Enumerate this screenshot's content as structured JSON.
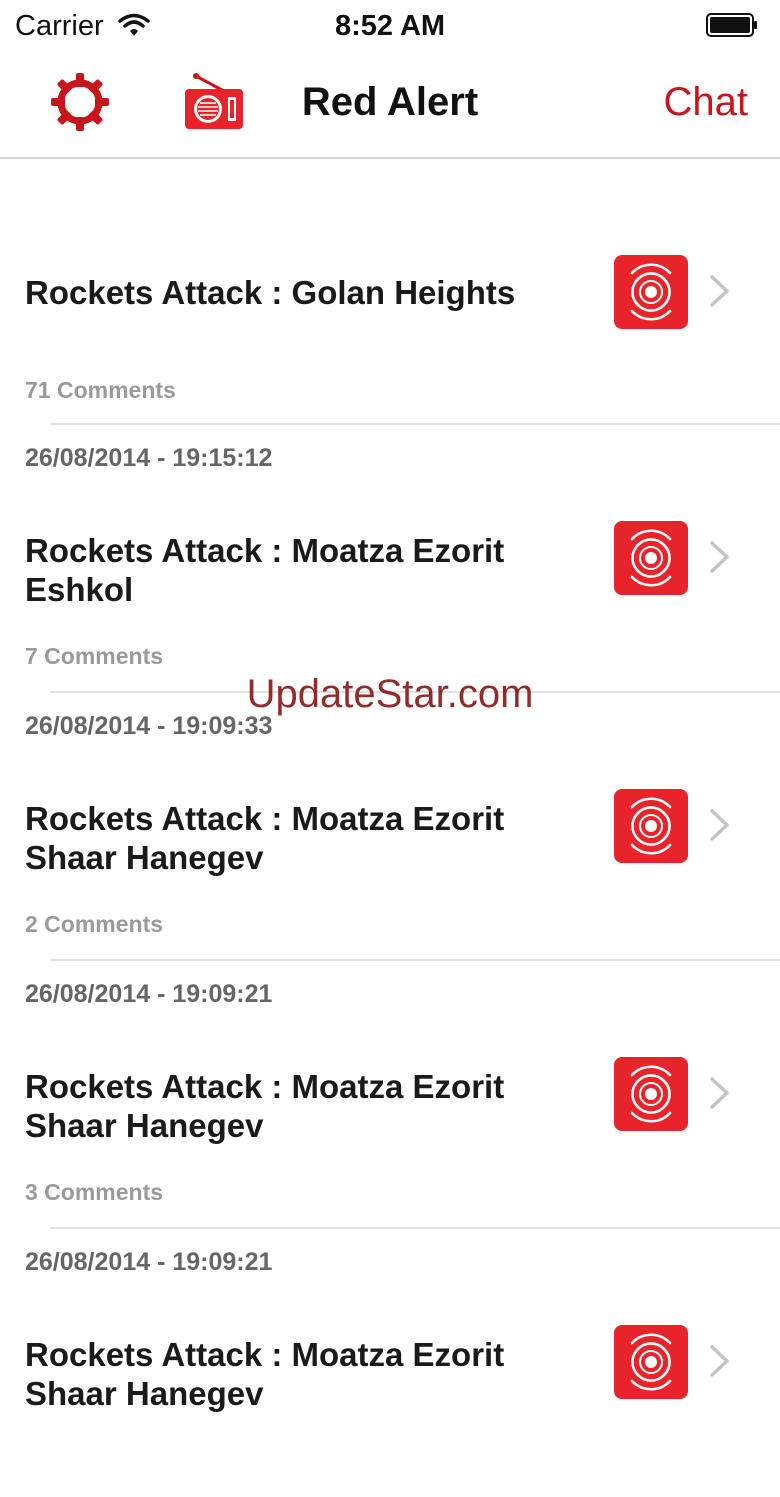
{
  "status_bar": {
    "carrier": "Carrier",
    "time": "8:52 AM"
  },
  "nav": {
    "title": "Red Alert",
    "chat_label": "Chat",
    "left_icons": [
      "gear-icon",
      "radio-icon"
    ]
  },
  "colors": {
    "accent": "#c8141b",
    "alert_icon_bg": "#e8232a",
    "date_text": "#666666",
    "comments_text": "#9a9a9a"
  },
  "alerts": [
    {
      "date": "",
      "title": "Rockets Attack : Golan Heights",
      "comments": "71 Comments",
      "icon": "siren-icon"
    },
    {
      "date": "26/08/2014 - 19:15:12",
      "title": "Rockets Attack : Moatza Ezorit Eshkol",
      "comments": "7 Comments",
      "icon": "siren-icon"
    },
    {
      "date": "26/08/2014 - 19:09:33",
      "title": "Rockets Attack : Moatza Ezorit Shaar Hanegev",
      "comments": "2 Comments",
      "icon": "siren-icon"
    },
    {
      "date": "26/08/2014 - 19:09:21",
      "title": "Rockets Attack : Moatza Ezorit Shaar Hanegev",
      "comments": "3 Comments",
      "icon": "siren-icon"
    },
    {
      "date": "26/08/2014 - 19:09:21",
      "title": "Rockets Attack : Moatza Ezorit Shaar Hanegev",
      "comments": "",
      "icon": "siren-icon"
    }
  ],
  "watermark": "UpdateStar.com"
}
